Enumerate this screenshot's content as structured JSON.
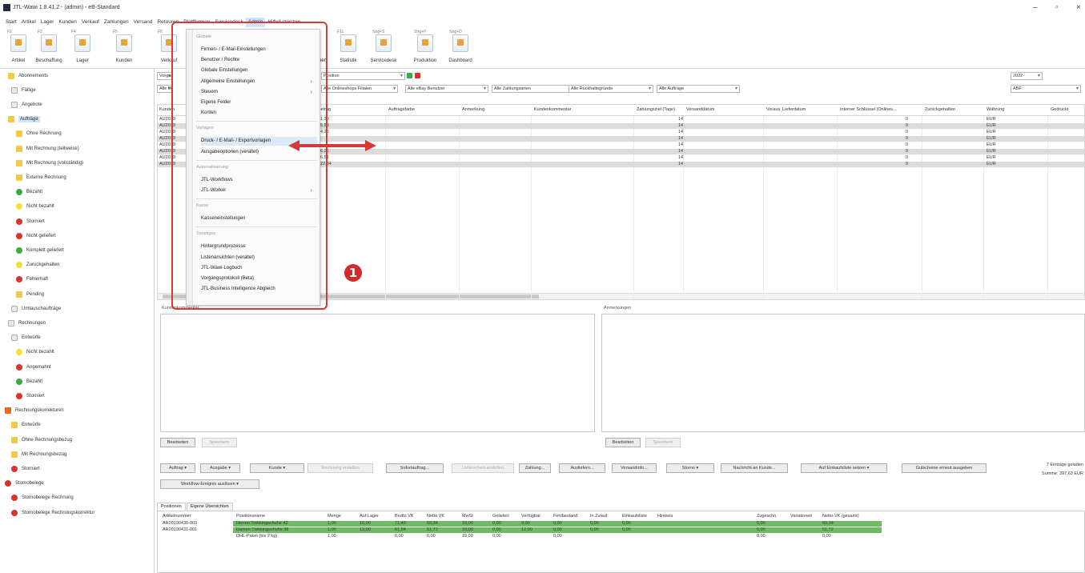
{
  "window": {
    "title": "JTL-Wawi 1.8.41.2 - (admin) - eB-Standard",
    "controls": [
      "–",
      "▫",
      "×"
    ]
  },
  "menubar": {
    "items": [
      "Start",
      "Artikel",
      "Lager",
      "Kunden",
      "Verkauf",
      "Zahlungen",
      "Versand",
      "Retouren",
      "Plattformen",
      "Servicedesk",
      "Admin",
      "Hilfe/Lizenzen"
    ]
  },
  "ribbon": {
    "buttons": [
      {
        "key": "F2",
        "label": "Artikel"
      },
      {
        "key": "F3",
        "label": "Beschaffung"
      },
      {
        "key": "F4",
        "label": "Lager"
      },
      {
        "key": "F5",
        "label": "Kunden"
      },
      {
        "key": "F6",
        "label": "Verkauf"
      },
      {
        "key": "F11",
        "label": "Statistik"
      },
      {
        "key": "Strg+S",
        "label": "Servicedesk"
      },
      {
        "key": "Strg+P",
        "label": "Produktion"
      },
      {
        "key": "Strg+D",
        "label": "Dashboard"
      }
    ],
    "partial_label": "nen"
  },
  "sidebar": {
    "items": [
      {
        "label": "Abonnements",
        "icon": "folder-icon"
      },
      {
        "label": "Fällige",
        "icon": "document-icon"
      },
      {
        "label": "Angebote",
        "icon": "document-icon"
      },
      {
        "label": "Aufträge",
        "icon": "folder-icon"
      },
      {
        "label": "Ohne Rechnung",
        "icon": "folder-icon"
      },
      {
        "label": "Mit Rechnung (teilweise)",
        "icon": "folder-icon"
      },
      {
        "label": "Mit Rechnung (vollständig)",
        "icon": "folder-icon"
      },
      {
        "label": "Externe Rechnung",
        "icon": "folder-icon"
      },
      {
        "label": "Bezahlt",
        "icon": "green-status-icon"
      },
      {
        "label": "Nicht bezahlt",
        "icon": "yellow-status-icon"
      },
      {
        "label": "Storniert",
        "icon": "red-status-icon"
      },
      {
        "label": "Nicht geliefert",
        "icon": "red-status-icon"
      },
      {
        "label": "Komplett geliefert",
        "icon": "green-status-icon"
      },
      {
        "label": "Zurückgehalten",
        "icon": "yellow-status-icon"
      },
      {
        "label": "Fehlerhaft",
        "icon": "red-status-icon"
      },
      {
        "label": "Pending",
        "icon": "folder-icon"
      },
      {
        "label": "Umtauschaufträge",
        "icon": "document-icon"
      },
      {
        "label": "Rechnungen",
        "icon": "document-icon"
      },
      {
        "label": "Entwürfe",
        "icon": "document-icon"
      },
      {
        "label": "Nicht bezahlt",
        "icon": "yellow-status-icon"
      },
      {
        "label": "Angemahnt",
        "icon": "red-status-icon"
      },
      {
        "label": "Bezahlt",
        "icon": "green-status-icon"
      },
      {
        "label": "Storniert",
        "icon": "red-status-icon"
      },
      {
        "label": "Rechnungskorrekturen",
        "icon": "flag-icon"
      },
      {
        "label": "Entwürfe",
        "icon": "folder-icon"
      },
      {
        "label": "Ohne Rechnungsbezug",
        "icon": "folder-icon"
      },
      {
        "label": "Mit Rechnungsbezug",
        "icon": "folder-icon"
      },
      {
        "label": "Storniert",
        "icon": "red-status-icon"
      },
      {
        "label": "Stornobelege",
        "icon": "red-status-icon"
      },
      {
        "label": "Stornobelege Rechnung",
        "icon": "red-status-icon"
      },
      {
        "label": "Stornobelege Rechnungskorrektur",
        "icon": "red-status-icon"
      }
    ],
    "selected_index": 3
  },
  "filters": {
    "search_placeholder": "Vorgang",
    "row1_partial": "Position",
    "row2": [
      "Alle Firmen",
      "Alle Onlineshops Filialen",
      "Alle eBay Benutzer",
      "Alle Zahlungsarten",
      "Alle Rückhaltegründe",
      "Alle Aufträge"
    ],
    "year": "2022",
    "user": "ABF"
  },
  "grid": {
    "columns": [
      "Kunden",
      "Betrag",
      "Auftragsfarbe",
      "Anmerkung",
      "Kundenkommentar",
      "Zahlungsziel (Tage)",
      "Versanddatum",
      "Voraus. Lieferdatum",
      "Interner Schlüssel (Onlines...",
      "Zurückgehalten",
      "Währung",
      "Gedruckt"
    ],
    "rows": [
      {
        "kunde": "AU2019",
        "betrag": "71,30",
        "ziel": "14",
        "zurueck": "0",
        "waehrung": "EUR"
      },
      {
        "kunde": "AU2019",
        "betrag": "25,89",
        "ziel": "14",
        "zurueck": "0",
        "waehrung": "EUR"
      },
      {
        "kunde": "AU2019",
        "betrag": "34,26",
        "ziel": "14",
        "zurueck": "0",
        "waehrung": "EUR"
      },
      {
        "kunde": "AU2019",
        "betrag": "",
        "ziel": "14",
        "zurueck": "0",
        "waehrung": "EUR"
      },
      {
        "kunde": "AU2019",
        "betrag": "",
        "ziel": "14",
        "zurueck": "0",
        "waehrung": "EUR"
      },
      {
        "kunde": "AU2019",
        "betrag": "36,26",
        "ziel": "14",
        "zurueck": "0",
        "waehrung": "EUR"
      },
      {
        "kunde": "AU2019",
        "betrag": "56,51",
        "ziel": "14",
        "zurueck": "0",
        "waehrung": "EUR"
      },
      {
        "kunde": "AU2019",
        "betrag": "122,34",
        "ziel": "14",
        "zurueck": "0",
        "waehrung": "EUR"
      }
    ]
  },
  "comments": {
    "left_label": "Kundenkommentar",
    "right_label": "Anmerkungen",
    "edit": "Bearbeiten",
    "save": "Speichern"
  },
  "actions": {
    "row1": [
      "Auftrag",
      "Ausgabe",
      "Kunde",
      "Rechnung erstellen",
      "Sofortauftrag...",
      "Lieferschein erstellen",
      "Zahlung...",
      "Ausliefern...",
      "Versandinfo...",
      "Storno",
      "Nachricht an Kunde...",
      "Auf Einkaufsliste setzen",
      "Gutscheine erneut ausgeben"
    ],
    "row2": "Workflow-Ereignis auslösen",
    "summary_count": "7 Einträge geladen",
    "summary_sum": "Summe: 397,63 EUR"
  },
  "bottom": {
    "tabs": [
      "Positionen",
      "Eigene Übersichten"
    ],
    "columns": [
      "Artikelnummer",
      "Positionsname",
      "Menge",
      "Auf Lager",
      "Brutto VK",
      "Netto VK",
      "MwSt",
      "Geliefert",
      "Verfügbar",
      "Fehlbestand",
      "In Zulauf",
      "Einkaufsliste",
      "Hinweis",
      "Zugeschn.",
      "Variationen",
      "Netto-VK (gesamt)"
    ],
    "rows": [
      {
        "nr": "AR20190430-003",
        "name": "Herren Trekkingschuhe 42",
        "menge": "1,00",
        "lager": "10,00",
        "brutto": "71,40",
        "netto": "60,34",
        "mwst": "19,00",
        "gel": "0,00",
        "verf": "9,00",
        "fehl": "0,00",
        "zulauf": "0,00",
        "ek": "0,00",
        "zug": "0,00",
        "ges": "60,34"
      },
      {
        "nr": "AR20190431-001",
        "name": "Damen Trekkingschuhe 38",
        "menge": "1,00",
        "lager": "13,00",
        "brutto": "61,54",
        "netto": "51,72",
        "mwst": "19,00",
        "gel": "0,00",
        "verf": "12,00",
        "fehl": "0,00",
        "zulauf": "0,00",
        "ek": "0,00",
        "zug": "0,00",
        "ges": "51,72"
      },
      {
        "nr": "",
        "name": "DHL-Paket (bis 2 kg)",
        "menge": "1,00",
        "lager": "",
        "brutto": "0,00",
        "netto": "0,00",
        "mwst": "19,00",
        "gel": "0,00",
        "verf": "",
        "fehl": "0,00",
        "zulauf": "",
        "ek": "",
        "zug": "0,00",
        "ges": "0,00"
      }
    ]
  },
  "admin_menu": {
    "sections": [
      {
        "header": "Globale",
        "items": [
          {
            "label": "Firmen- / E-Mail-Einstellungen",
            "sub": false
          },
          {
            "label": "Benutzer / Rechte",
            "sub": false
          },
          {
            "label": "Globale Einstellungen",
            "sub": false
          },
          {
            "label": "Allgemeine Einstellungen",
            "sub": true
          },
          {
            "label": "Steuern",
            "sub": true
          },
          {
            "label": "Eigene Felder",
            "sub": false
          },
          {
            "label": "Konten",
            "sub": false
          }
        ]
      },
      {
        "header": "Vorlagen",
        "items": [
          {
            "label": "Druck- / E-Mail- / Exportvorlagen",
            "sub": false
          },
          {
            "label": "Ausgabeoptionen (veraltet)",
            "sub": false
          }
        ]
      },
      {
        "header": "Automatisierung",
        "items": [
          {
            "label": "JTL-Workflows",
            "sub": false
          },
          {
            "label": "JTL-Worker",
            "sub": true
          }
        ]
      },
      {
        "header": "Kasse",
        "items": [
          {
            "label": "Kasseneinstellungen",
            "sub": false
          }
        ]
      },
      {
        "header": "Sonstiges",
        "items": [
          {
            "label": "Hintergrundprozesse",
            "sub": false
          },
          {
            "label": "Listenansichten (veraltet)",
            "sub": false
          },
          {
            "label": "JTL-Wawi-Logbuch",
            "sub": false
          },
          {
            "label": "Vorgangsprotokoll (Beta)",
            "sub": false
          },
          {
            "label": "JTL-Business Intelligence Abgleich",
            "sub": false
          }
        ]
      }
    ]
  },
  "annotation": {
    "step": "1",
    "color": "#d42a2c"
  }
}
